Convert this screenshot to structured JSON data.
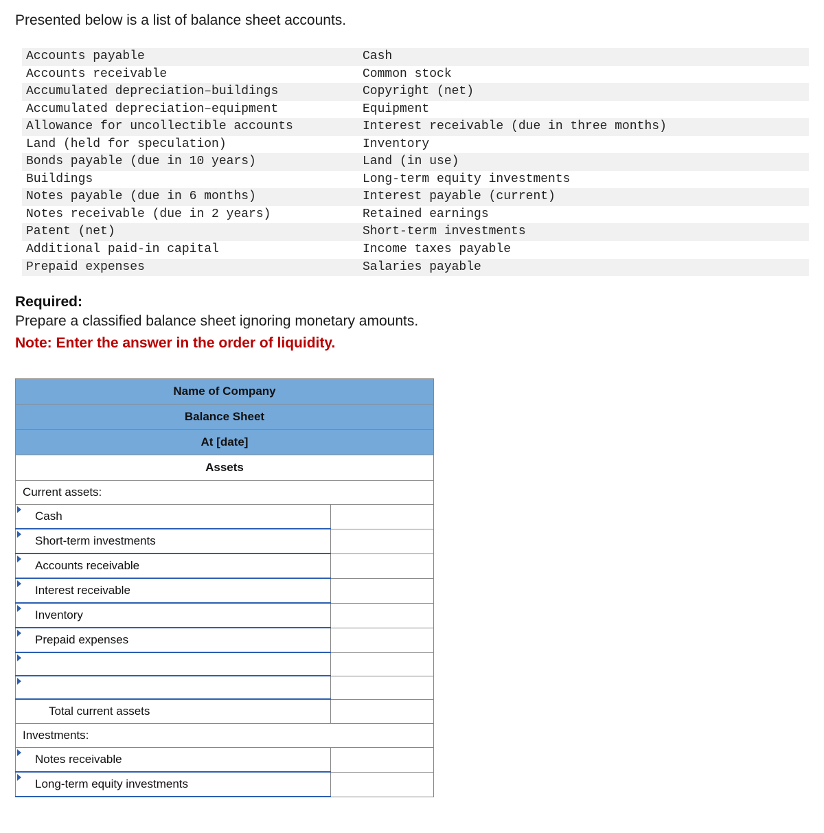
{
  "intro": "Presented below is a list of balance sheet accounts.",
  "accounts": {
    "left": [
      "Accounts payable",
      "Accounts receivable",
      "Accumulated depreciation–buildings",
      "Accumulated depreciation–equipment",
      "Allowance for uncollectible accounts",
      "Land (held for speculation)",
      "Bonds payable (due in 10 years)",
      "Buildings",
      "Notes payable (due in 6 months)",
      "Notes receivable (due in 2 years)",
      "Patent (net)",
      "Additional paid-in capital",
      "Prepaid expenses"
    ],
    "right": [
      "Cash",
      "Common stock",
      "Copyright (net)",
      "Equipment",
      "Interest receivable (due in three months)",
      "Inventory",
      "Land (in use)",
      "Long-term equity investments",
      "Interest payable (current)",
      "Retained earnings",
      "Short-term investments",
      "Income taxes payable",
      "Salaries payable"
    ]
  },
  "required": {
    "label": "Required:",
    "text": "Prepare a classified balance sheet ignoring monetary amounts.",
    "note": "Note: Enter the answer in the order of liquidity."
  },
  "sheet": {
    "header1": "Name of Company",
    "header2": "Balance Sheet",
    "header3": "At [date]",
    "sectionAssets": "Assets",
    "rows": [
      {
        "type": "category",
        "label": "Current assets:"
      },
      {
        "type": "input",
        "label": "Cash"
      },
      {
        "type": "input",
        "label": "Short-term investments"
      },
      {
        "type": "input",
        "label": "Accounts receivable"
      },
      {
        "type": "input",
        "label": "Interest receivable"
      },
      {
        "type": "input",
        "label": "Inventory"
      },
      {
        "type": "input",
        "label": "Prepaid expenses"
      },
      {
        "type": "input",
        "label": ""
      },
      {
        "type": "input",
        "label": ""
      },
      {
        "type": "total",
        "label": "Total current assets"
      },
      {
        "type": "category",
        "label": "Investments:"
      },
      {
        "type": "input",
        "label": "Notes receivable"
      },
      {
        "type": "input",
        "label": "Long-term equity investments"
      }
    ]
  }
}
